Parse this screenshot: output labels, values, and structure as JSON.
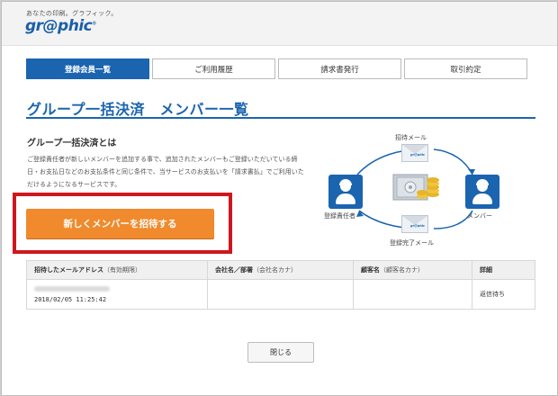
{
  "header": {
    "tagline": "あなたの印刷。グラフィック。",
    "logo_text": "gr@phic",
    "logo_mark": "®"
  },
  "tabs": [
    {
      "label": "登録会員一覧",
      "active": true
    },
    {
      "label": "ご利用履歴",
      "active": false
    },
    {
      "label": "請求書発行",
      "active": false
    },
    {
      "label": "取引約定",
      "active": false
    }
  ],
  "page_title": "グループ一括決済　メンバー一覧",
  "section": {
    "heading": "グループ一括決済とは",
    "description": "ご登録責任者が新しいメンバーを追加する事で、追加されたメンバーもご登録いただいている締日・お支払日などのお支払条件と同じ条件で、当サービスのお支払いを「請求書払」でご利用いただけるようになるサービスです。"
  },
  "invite_button": "新しくメンバーを招待する",
  "diagram": {
    "top_label": "招待メール",
    "bottom_label": "登録完了メール",
    "left_label": "登録責任者",
    "right_label": "メンバー",
    "envelope_text": "gr@phic"
  },
  "table": {
    "headers": [
      {
        "main": "招待したメールアドレス",
        "sub": "（有効期限）"
      },
      {
        "main": "会社名／部署",
        "sub": "（会社名カナ）"
      },
      {
        "main": "顧客名",
        "sub": "（顧客名カナ）"
      },
      {
        "main": "詳細",
        "sub": ""
      }
    ],
    "rows": [
      {
        "email": "",
        "expiry": "2018/02/05 11:25:42",
        "company": "",
        "customer": "",
        "status": "返信待ち"
      }
    ]
  },
  "close_button": "閉じる",
  "colors": {
    "accent": "#1b64b0",
    "orange": "#f08a2c",
    "highlight": "#d0161d"
  }
}
